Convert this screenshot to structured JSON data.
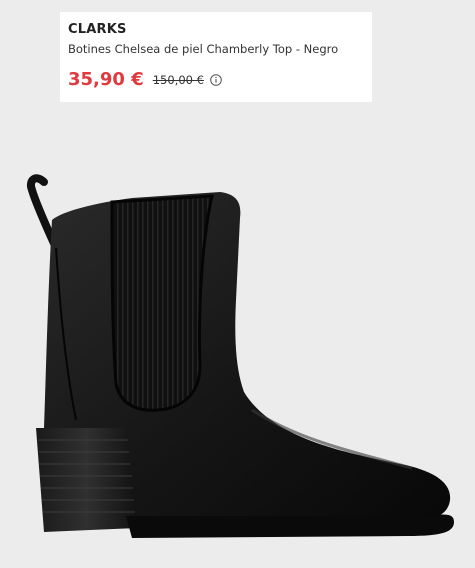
{
  "product": {
    "brand": "CLARKS",
    "name": "Botines Chelsea de piel Chamberly Top - Negro",
    "sale_price": "35,90 €",
    "original_price": "150,00 €"
  },
  "icons": {
    "info": "info-circle-icon"
  },
  "colors": {
    "sale_price": "#e03a3e",
    "page_background": "#ececec",
    "card_background": "#ffffff"
  },
  "image": {
    "subject": "black leather chelsea boot with block heel"
  }
}
